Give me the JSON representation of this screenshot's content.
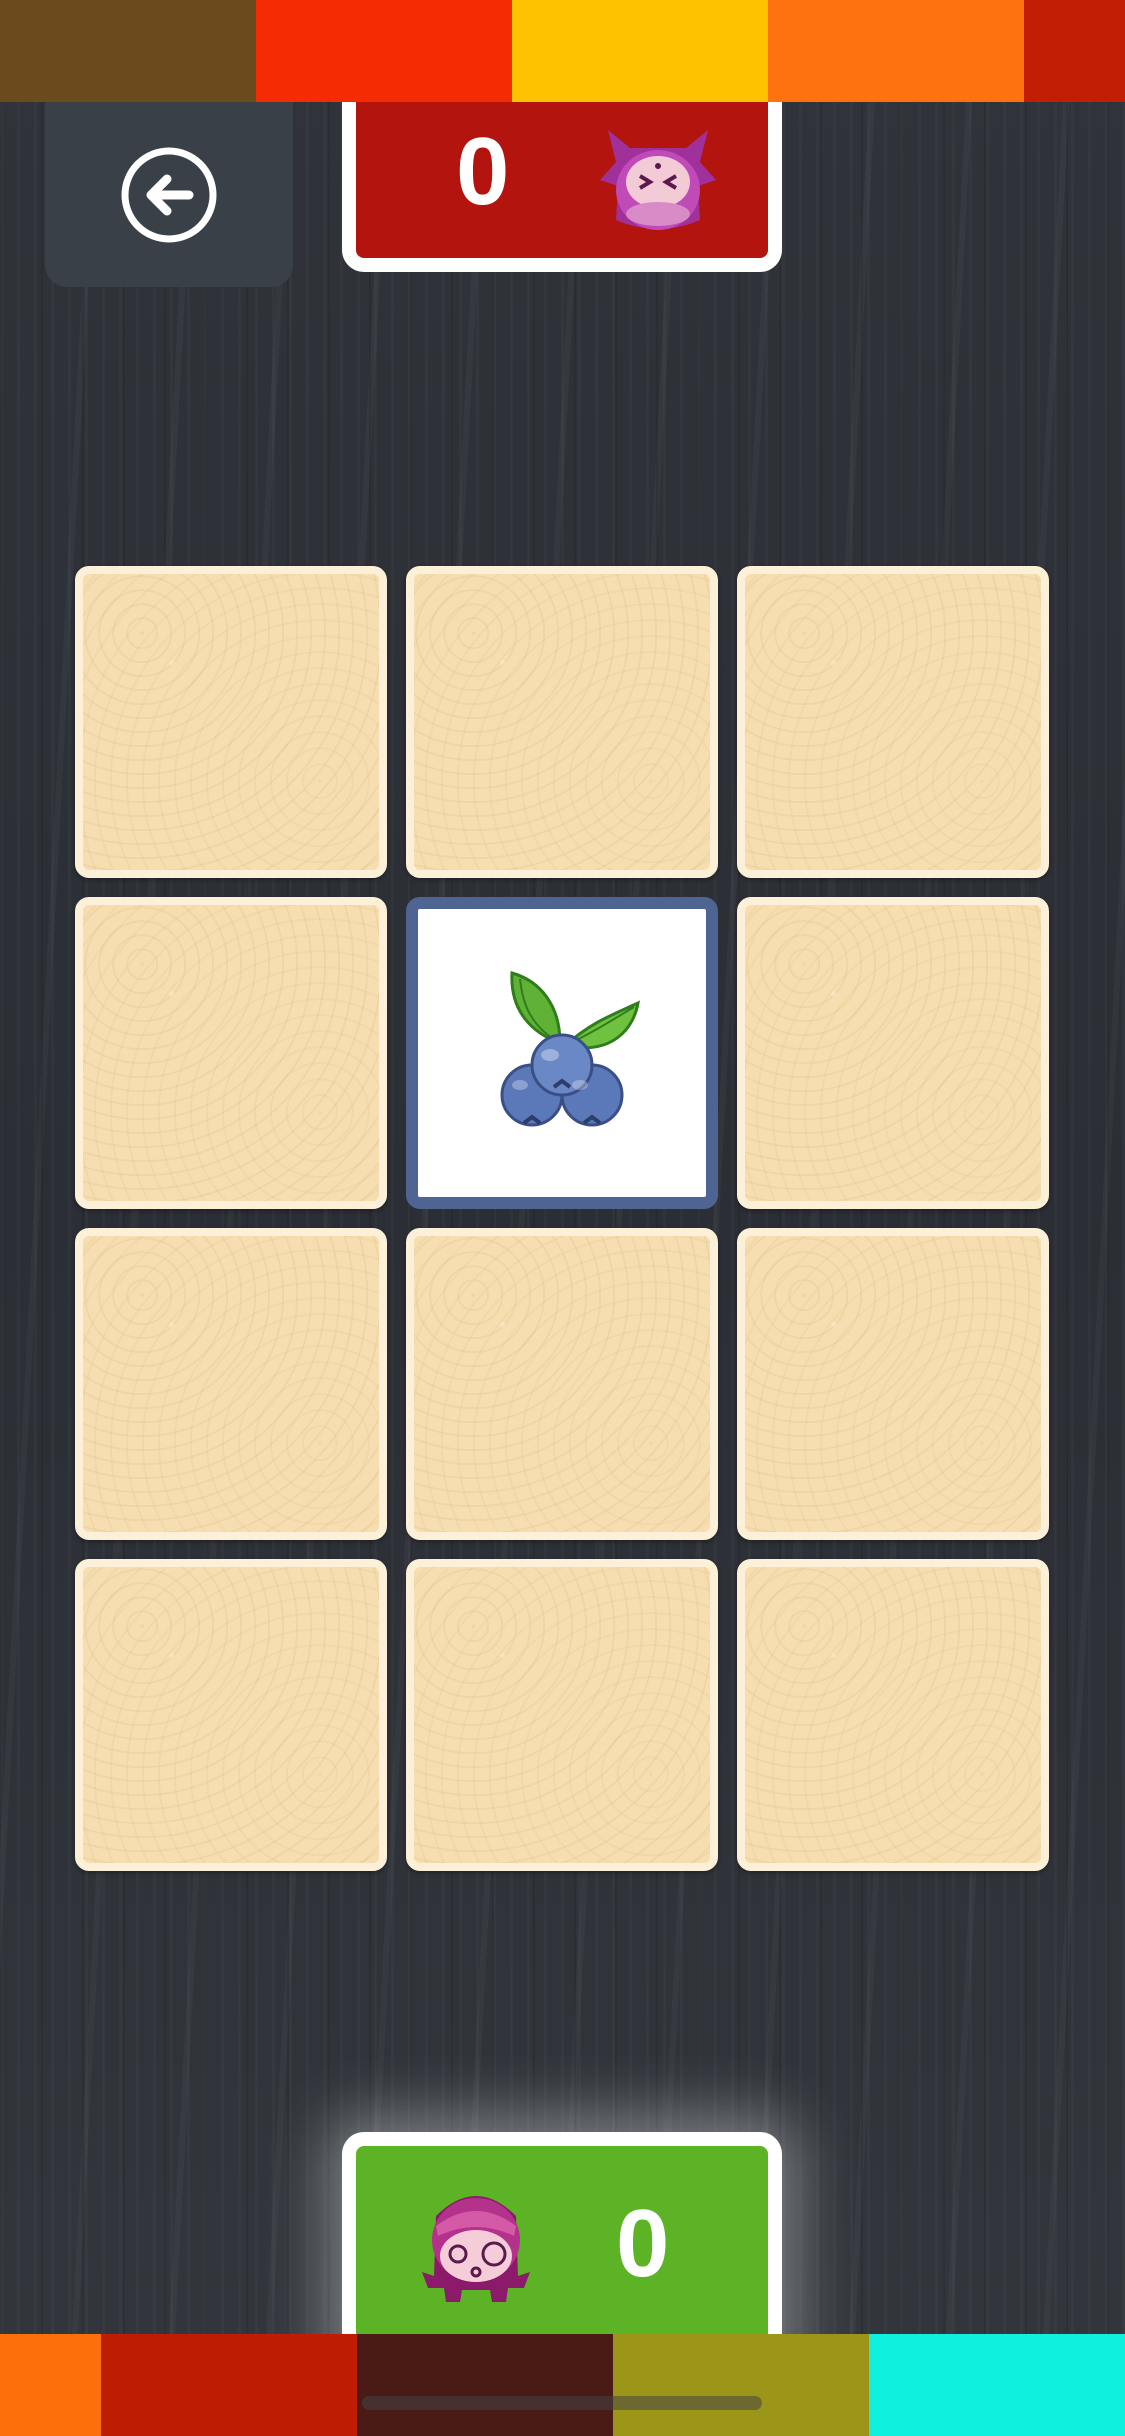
{
  "top_stripes": [
    "#6b4a1e",
    "#f52b03",
    "#ffc201",
    "#fe7310",
    "#c21e03"
  ],
  "bottom_stripes": [
    "#fd6f0a",
    "#be1d04",
    "#4a1a14",
    "#9b9617",
    "#0ff0df",
    "#0ff0df"
  ],
  "back_button": {
    "icon": "back-arrow-icon"
  },
  "opponent": {
    "score": "0",
    "avatar": "purple-monster-avatar",
    "panel_color": "#b3140e"
  },
  "player": {
    "score": "0",
    "avatar": "pink-monster-avatar",
    "panel_color": "#5db326"
  },
  "board": {
    "rows": 4,
    "cols": 3,
    "cards": [
      {
        "state": "hidden"
      },
      {
        "state": "hidden"
      },
      {
        "state": "hidden"
      },
      {
        "state": "hidden"
      },
      {
        "state": "revealed",
        "image": "blueberries-icon"
      },
      {
        "state": "hidden"
      },
      {
        "state": "hidden"
      },
      {
        "state": "hidden"
      },
      {
        "state": "hidden"
      },
      {
        "state": "hidden"
      },
      {
        "state": "hidden"
      },
      {
        "state": "hidden"
      }
    ]
  }
}
